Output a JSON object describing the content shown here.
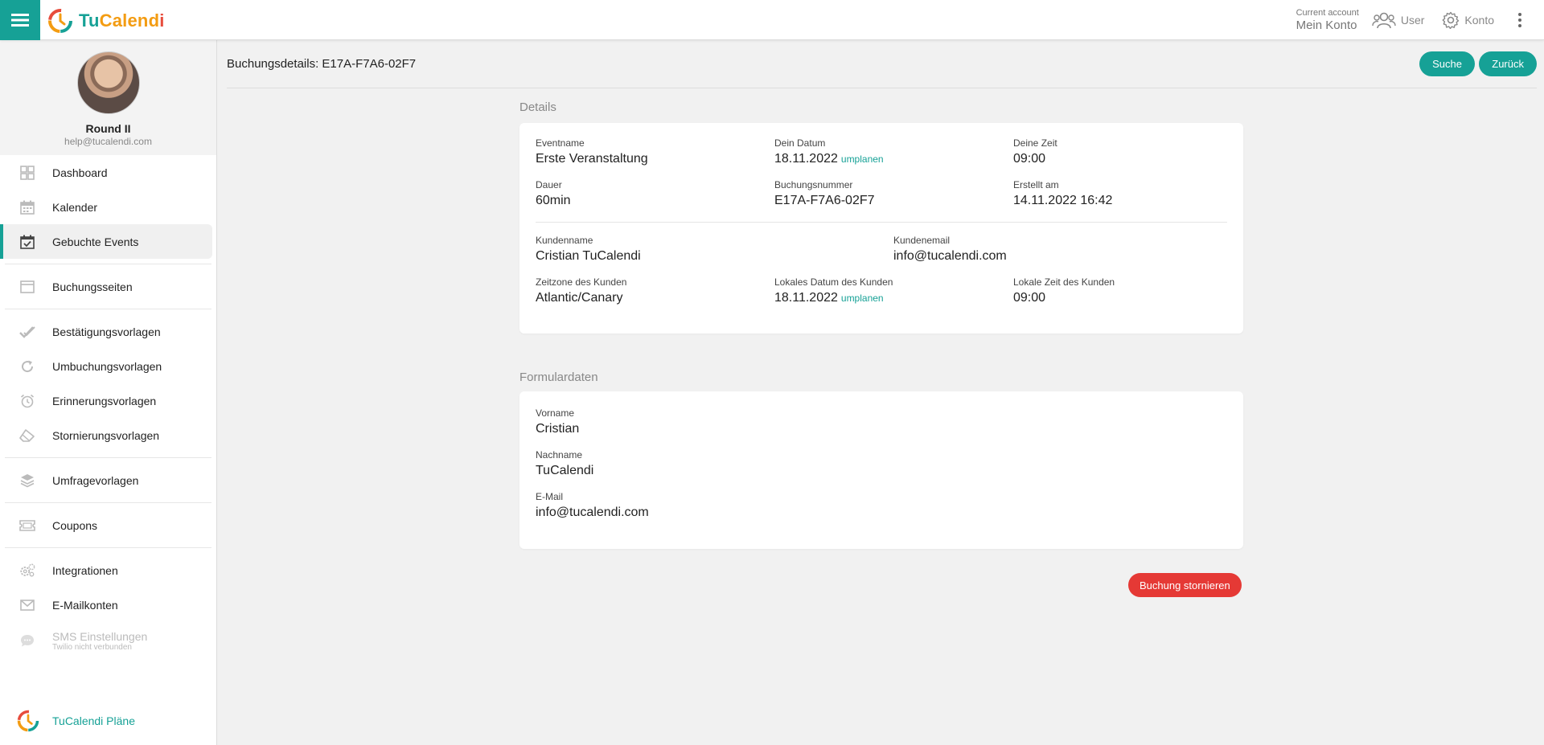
{
  "header": {
    "brand": {
      "part1": "Tu",
      "part2": "Calend",
      "part3": "i"
    },
    "account_small": "Current account",
    "account_main": "Mein Konto",
    "user_label": "User",
    "settings_label": "Konto"
  },
  "profile": {
    "name": "Round II",
    "email": "help@tucalendi.com"
  },
  "nav": {
    "items": [
      {
        "label": "Dashboard",
        "icon": "dashboard-icon"
      },
      {
        "label": "Kalender",
        "icon": "calendar-icon"
      },
      {
        "label": "Gebuchte Events",
        "icon": "calendar-check-icon",
        "active": true
      },
      {
        "label": "Buchungsseiten",
        "icon": "browser-window-icon"
      },
      {
        "label": "Bestätigungsvorlagen",
        "icon": "double-check-icon"
      },
      {
        "label": "Umbuchungsvorlagen",
        "icon": "refresh-icon"
      },
      {
        "label": "Erinnerungsvorlagen",
        "icon": "alarm-clock-icon"
      },
      {
        "label": "Stornierungsvorlagen",
        "icon": "eraser-icon"
      },
      {
        "label": "Umfragevorlagen",
        "icon": "layers-icon"
      },
      {
        "label": "Coupons",
        "icon": "ticket-icon"
      },
      {
        "label": "Integrationen",
        "icon": "gears-icon"
      },
      {
        "label": "E-Mailkonten",
        "icon": "envelope-icon"
      }
    ],
    "sms_title": "SMS Einstellungen",
    "sms_sub": "Twilio nicht verbunden",
    "plans": "TuCalendi Pläne"
  },
  "page": {
    "title": "Buchungsdetails: E17A-F7A6-02F7",
    "search_button": "Suche",
    "back_button": "Zurück"
  },
  "details": {
    "section_title": "Details",
    "eventname_label": "Eventname",
    "eventname": "Erste Veranstaltung",
    "date_label": "Dein Datum",
    "date": "18.11.2022",
    "reschedule": "umplanen",
    "time_label": "Deine Zeit",
    "time": "09:00",
    "duration_label": "Dauer",
    "duration": "60min",
    "booking_no_label": "Buchungsnummer",
    "booking_no": "E17A-F7A6-02F7",
    "created_label": "Erstellt am",
    "created": "14.11.2022 16:42",
    "customer_name_label": "Kundenname",
    "customer_name": "Cristian TuCalendi",
    "customer_email_label": "Kundenemail",
    "customer_email": "info@tucalendi.com",
    "tz_label": "Zeitzone des Kunden",
    "tz": "Atlantic/Canary",
    "local_date_label": "Lokales Datum des Kunden",
    "local_date": "18.11.2022",
    "local_time_label": "Lokale Zeit des Kunden",
    "local_time": "09:00"
  },
  "form": {
    "section_title": "Formulardaten",
    "firstname_label": "Vorname",
    "firstname": "Cristian",
    "lastname_label": "Nachname",
    "lastname": "TuCalendi",
    "email_label": "E-Mail",
    "email": "info@tucalendi.com"
  },
  "actions": {
    "cancel_booking": "Buchung stornieren"
  },
  "colors": {
    "accent": "#16a196",
    "danger": "#e53935"
  }
}
